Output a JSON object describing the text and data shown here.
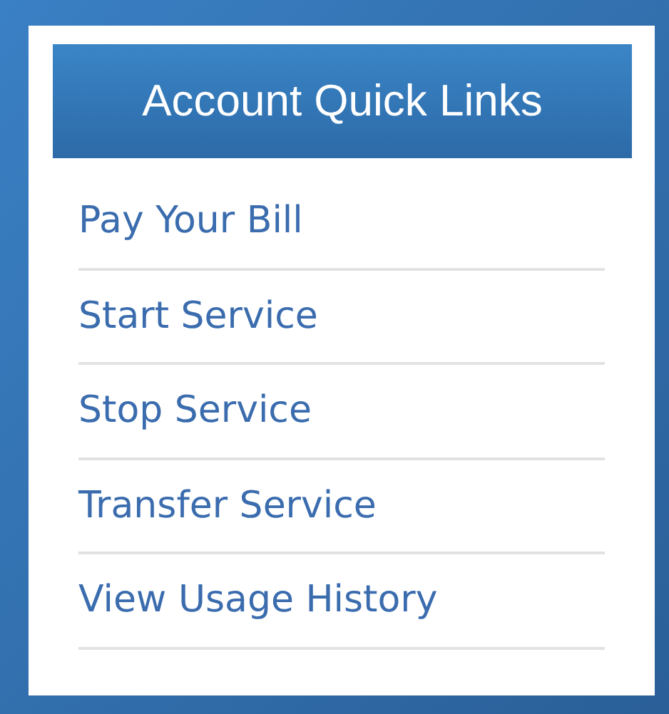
{
  "panel": {
    "title": "Account Quick Links",
    "links": [
      {
        "label": "Pay Your Bill"
      },
      {
        "label": "Start Service"
      },
      {
        "label": "Stop Service"
      },
      {
        "label": "Transfer Service"
      },
      {
        "label": "View Usage History"
      }
    ]
  }
}
